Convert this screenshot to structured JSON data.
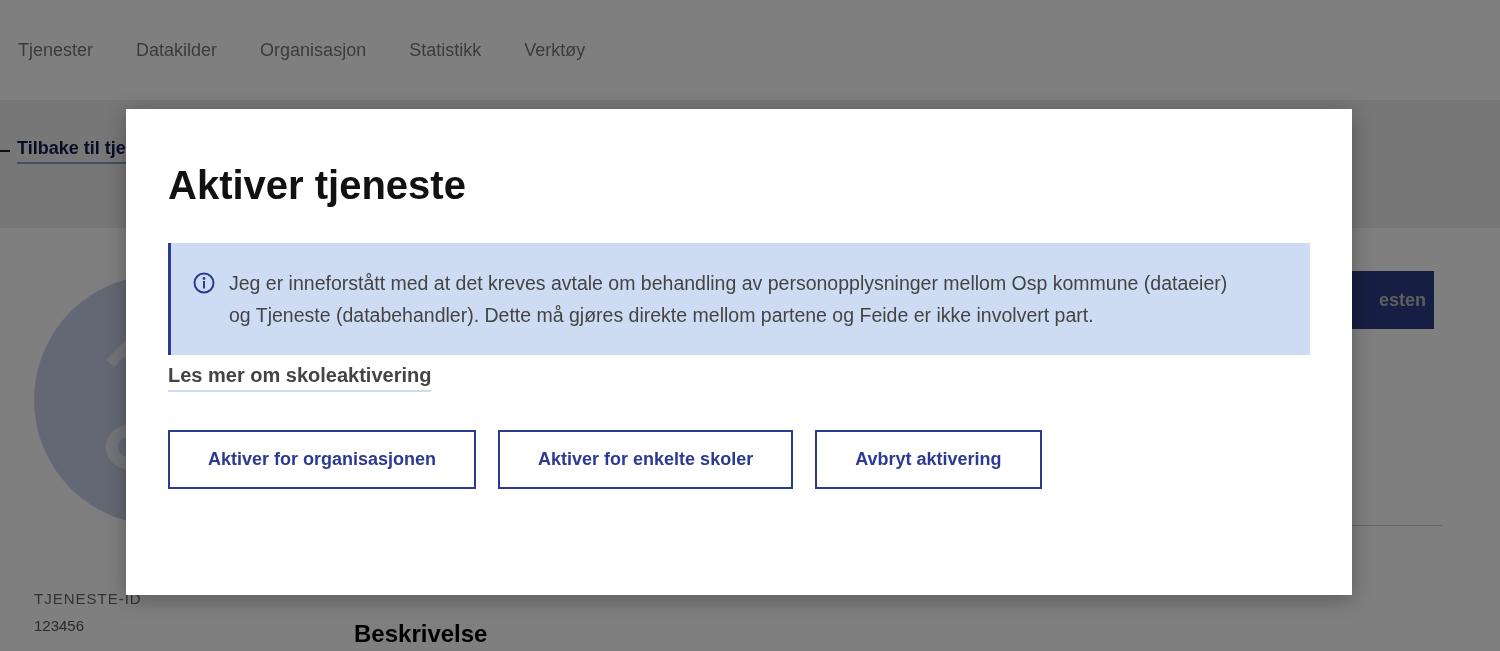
{
  "nav": {
    "items": [
      "Tjenester",
      "Datakilder",
      "Organisasjon",
      "Statistikk",
      "Verktøy"
    ]
  },
  "back_link": "Tilbake til tje",
  "header_button": "esten",
  "details": {
    "id_label": "TJENESTE-ID",
    "id_value": "123456",
    "heading": "Beskrivelse"
  },
  "modal": {
    "title": "Aktiver tjeneste",
    "info": "Jeg er inneforstått med at det kreves avtale om behandling av personopplysninger mellom Osp kommune (dataeier) og Tjeneste (databehandler). Dette må gjøres direkte mellom partene og Feide er ikke involvert part.",
    "link": "Les mer om skoleaktivering",
    "buttons": [
      "Aktiver for organisasjonen",
      "Aktiver for enkelte skoler",
      "Avbryt aktivering"
    ]
  }
}
